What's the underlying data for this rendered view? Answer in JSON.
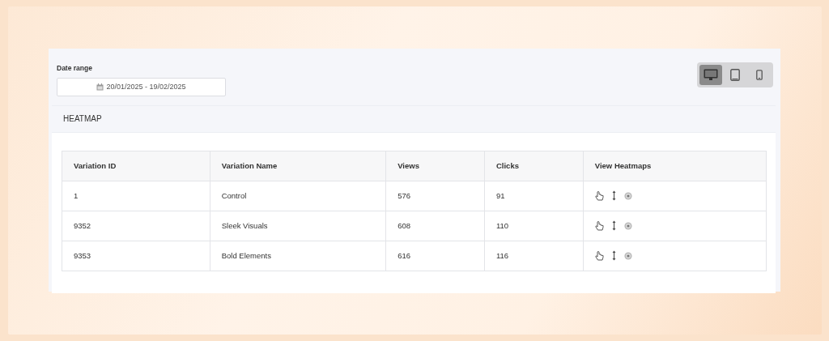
{
  "date_range": {
    "label": "Date range",
    "value": "20/01/2025 - 19/02/2025"
  },
  "devices": [
    {
      "kind": "desktop",
      "selected": true
    },
    {
      "kind": "tablet",
      "selected": false
    },
    {
      "kind": "mobile",
      "selected": false
    }
  ],
  "heatmap": {
    "title": "HEATMAP",
    "table": {
      "columns": [
        "Variation ID",
        "Variation Name",
        "Views",
        "Clicks",
        "View Heatmaps"
      ],
      "rows": [
        {
          "id": "1",
          "name": "Control",
          "views": "576",
          "clicks": "91"
        },
        {
          "id": "9352",
          "name": "Sleek Visuals",
          "views": "608",
          "clicks": "110"
        },
        {
          "id": "9353",
          "name": "Bold Elements",
          "views": "616",
          "clicks": "116"
        }
      ]
    }
  }
}
